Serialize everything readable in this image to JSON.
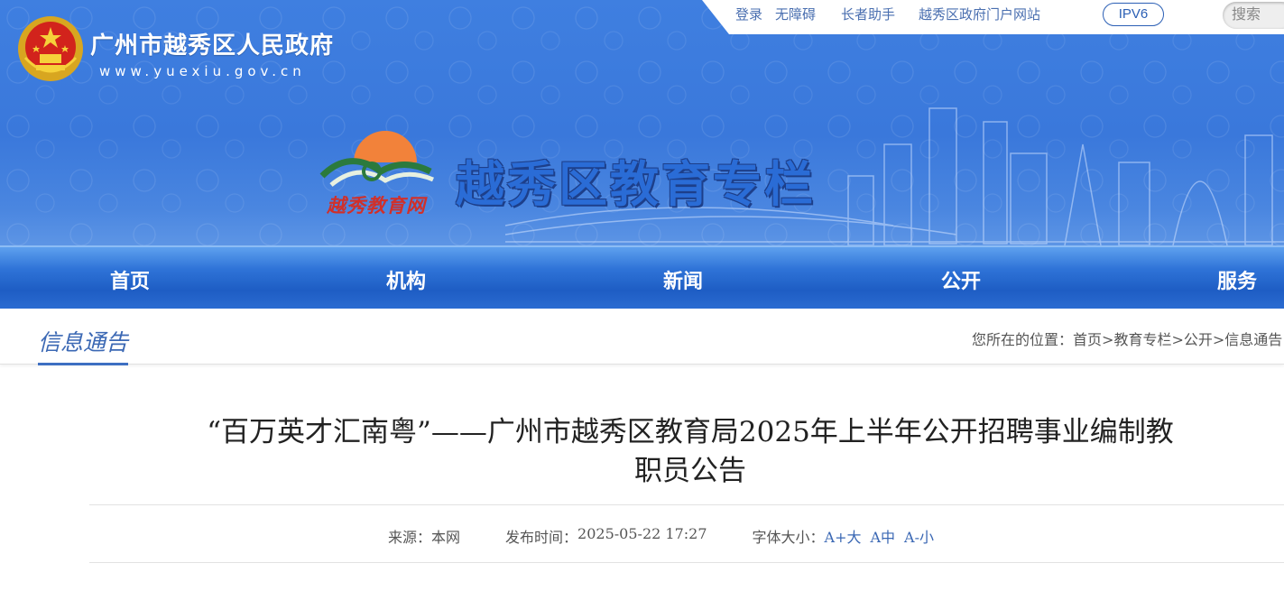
{
  "header": {
    "gov_name": "广州市越秀区人民政府",
    "gov_url": "www.yuexiu.gov.cn",
    "column_title": "越秀区教育专栏",
    "edu_logo_text": "越秀教育网",
    "top_links": {
      "login": "登录",
      "accessibility": "无障碍",
      "elder_assist": "长者助手",
      "portal": "越秀区政府门户网站",
      "ipv6": "IPV6",
      "search_placeholder": "搜索"
    }
  },
  "nav": {
    "items": [
      {
        "label": "首页"
      },
      {
        "label": "机构"
      },
      {
        "label": "新闻"
      },
      {
        "label": "公开"
      },
      {
        "label": "服务"
      }
    ]
  },
  "section": {
    "title": "信息通告",
    "breadcrumb_prefix": "您所在的位置：",
    "breadcrumb": [
      "首页",
      "教育专栏",
      "公开",
      "信息通告"
    ]
  },
  "article": {
    "title_line1": "“百万英才汇南粤”——广州市越秀区教育局2025年上半年公开招聘事业编制教",
    "title_line2": "职员公告",
    "source_label": "来源：",
    "source_value": "本网",
    "publish_label": "发布时间：",
    "publish_value": "2025-05-22 17:27",
    "font_size_label": "字体大小：",
    "font_large": "A+大",
    "font_medium": "A中",
    "font_small": "A-小"
  },
  "colors": {
    "banner_blue": "#3a78db",
    "nav_blue": "#1e5dc4",
    "accent_link": "#3b68b4"
  }
}
